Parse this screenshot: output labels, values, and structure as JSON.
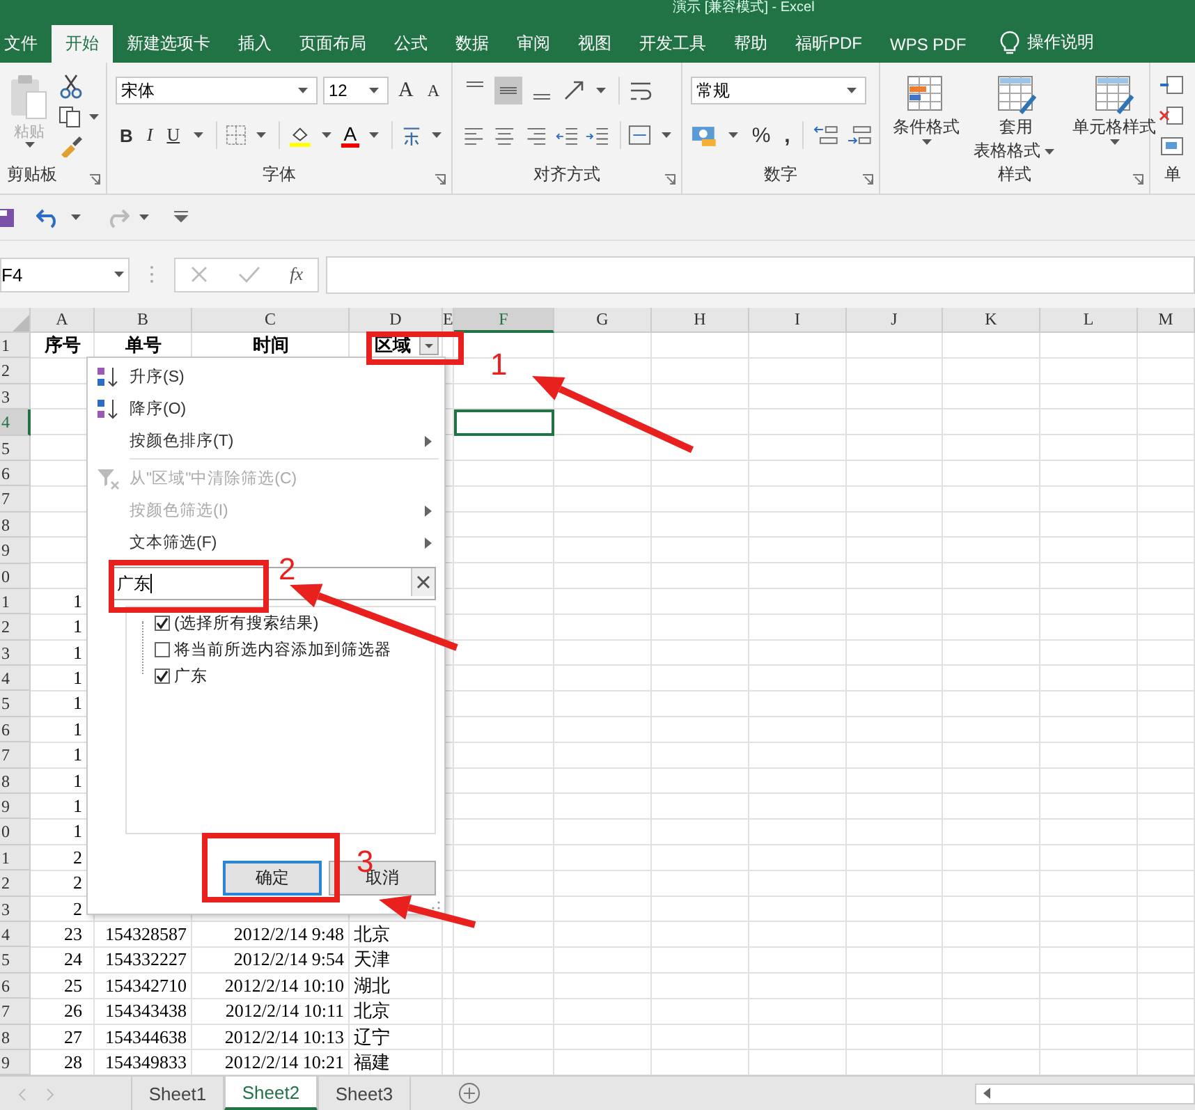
{
  "window": {
    "title": "演示 [兼容模式] - Excel"
  },
  "tabs": [
    {
      "label": "文件",
      "selected": false
    },
    {
      "label": "开始",
      "selected": true
    },
    {
      "label": "新建选项卡",
      "selected": false
    },
    {
      "label": "插入",
      "selected": false
    },
    {
      "label": "页面布局",
      "selected": false
    },
    {
      "label": "公式",
      "selected": false
    },
    {
      "label": "数据",
      "selected": false
    },
    {
      "label": "审阅",
      "selected": false
    },
    {
      "label": "视图",
      "selected": false
    },
    {
      "label": "开发工具",
      "selected": false
    },
    {
      "label": "帮助",
      "selected": false
    },
    {
      "label": "福昕PDF",
      "selected": false
    },
    {
      "label": "WPS PDF",
      "selected": false
    }
  ],
  "tell_me": "操作说明",
  "ribbon": {
    "groups": [
      {
        "kind": "clipboard",
        "label": "剪贴板",
        "paste": {
          "label": "粘贴",
          "disabled": true
        }
      },
      {
        "kind": "font",
        "label": "字体",
        "font_name": "宋体",
        "font_size": "12",
        "grow": "A",
        "shrink": "A",
        "bold": "B",
        "italic": "I",
        "underline": "U",
        "font_color": "A"
      },
      {
        "kind": "alignment",
        "label": "对齐方式",
        "align_buttons": [
          {
            "kind": "top",
            "selected": false
          },
          {
            "kind": "middle",
            "selected": true
          },
          {
            "kind": "bottom",
            "selected": false
          }
        ]
      },
      {
        "kind": "number",
        "label": "数字",
        "format": "常规",
        "percent": "%",
        "comma": ","
      },
      {
        "kind": "styles",
        "label": "样式",
        "buttons": [
          {
            "lines": [
              "条件格式"
            ]
          },
          {
            "lines": [
              "套用",
              "表格格式"
            ]
          },
          {
            "lines": [
              "单元格样式"
            ]
          }
        ]
      },
      {
        "kind": "cells",
        "label": "单"
      }
    ]
  },
  "name_box": "F4",
  "formula_bar": {
    "fx": "fx"
  },
  "columns": [
    {
      "label": "A",
      "selected": false
    },
    {
      "label": "B",
      "selected": false
    },
    {
      "label": "C",
      "selected": false
    },
    {
      "label": "D",
      "selected": false
    },
    {
      "label": "E",
      "selected": false
    },
    {
      "label": "F",
      "selected": true
    },
    {
      "label": "G",
      "selected": false
    },
    {
      "label": "H",
      "selected": false
    },
    {
      "label": "I",
      "selected": false
    },
    {
      "label": "J",
      "selected": false
    },
    {
      "label": "K",
      "selected": false
    },
    {
      "label": "L",
      "selected": false
    },
    {
      "label": "M",
      "selected": false
    }
  ],
  "rows": [
    {
      "label": "1",
      "selected": false,
      "kind": "header",
      "a": "序号",
      "b": "单号",
      "c": "时间",
      "d": "区域",
      "filter_button": true
    },
    {
      "label": "2",
      "selected": false
    },
    {
      "label": "3",
      "selected": false
    },
    {
      "label": "4",
      "selected": true
    },
    {
      "label": "5",
      "selected": false
    },
    {
      "label": "6",
      "selected": false
    },
    {
      "label": "7",
      "selected": false
    },
    {
      "label": "8",
      "selected": false
    },
    {
      "label": "9",
      "selected": false
    },
    {
      "label": "0",
      "selected": false
    },
    {
      "label": "1",
      "selected": false,
      "kind": "data",
      "a": "1"
    },
    {
      "label": "2",
      "selected": false,
      "kind": "data",
      "a": "1"
    },
    {
      "label": "3",
      "selected": false,
      "kind": "data",
      "a": "1"
    },
    {
      "label": "4",
      "selected": false,
      "kind": "data",
      "a": "1"
    },
    {
      "label": "5",
      "selected": false,
      "kind": "data",
      "a": "1"
    },
    {
      "label": "6",
      "selected": false,
      "kind": "data",
      "a": "1"
    },
    {
      "label": "7",
      "selected": false,
      "kind": "data",
      "a": "1"
    },
    {
      "label": "8",
      "selected": false,
      "kind": "data",
      "a": "1"
    },
    {
      "label": "9",
      "selected": false,
      "kind": "data",
      "a": "1"
    },
    {
      "label": "0",
      "selected": false,
      "kind": "data",
      "a": "1"
    },
    {
      "label": "1",
      "selected": false,
      "kind": "data",
      "a": "2"
    },
    {
      "label": "2",
      "selected": false,
      "kind": "data",
      "a": "2"
    },
    {
      "label": "3",
      "selected": false,
      "kind": "data",
      "a": "2"
    },
    {
      "label": "4",
      "selected": false,
      "kind": "data",
      "a": "23",
      "b": "154328587",
      "c": "2012/2/14 9:48",
      "d": "北京"
    },
    {
      "label": "5",
      "selected": false,
      "kind": "data",
      "a": "24",
      "b": "154332227",
      "c": "2012/2/14 9:54",
      "d": "天津"
    },
    {
      "label": "6",
      "selected": false,
      "kind": "data",
      "a": "25",
      "b": "154342710",
      "c": "2012/2/14 10:10",
      "d": "湖北"
    },
    {
      "label": "7",
      "selected": false,
      "kind": "data",
      "a": "26",
      "b": "154343438",
      "c": "2012/2/14 10:11",
      "d": "北京"
    },
    {
      "label": "8",
      "selected": false,
      "kind": "data",
      "a": "27",
      "b": "154344638",
      "c": "2012/2/14 10:13",
      "d": "辽宁"
    },
    {
      "label": "9",
      "selected": false,
      "kind": "data",
      "a": "28",
      "b": "154349833",
      "c": "2012/2/14 10:21",
      "d": "福建"
    }
  ],
  "filter_menu": {
    "items": [
      {
        "kind": "sort-asc",
        "label": "升序(S)",
        "disabled": false,
        "submenu": false
      },
      {
        "kind": "sort-desc",
        "label": "降序(O)",
        "disabled": false,
        "submenu": false
      },
      {
        "kind": "item",
        "label": "按颜色排序(T)",
        "disabled": false,
        "submenu": true
      },
      {
        "kind": "separator"
      },
      {
        "kind": "clear-filter",
        "label": "从\"区域\"中清除筛选(C)",
        "disabled": true,
        "submenu": false
      },
      {
        "kind": "item",
        "label": "按颜色筛选(I)",
        "disabled": true,
        "submenu": true
      },
      {
        "kind": "item",
        "label": "文本筛选(F)",
        "disabled": false,
        "submenu": true
      }
    ],
    "search": {
      "value": "广东"
    },
    "list": [
      {
        "label": "(选择所有搜索结果)",
        "checked": true
      },
      {
        "label": "将当前所选内容添加到筛选器",
        "checked": false
      },
      {
        "label": "广东",
        "checked": true
      }
    ],
    "buttons": [
      {
        "label": "确定",
        "focused": true
      },
      {
        "label": "取消",
        "focused": false
      }
    ]
  },
  "annotations": [
    {
      "label": "1"
    },
    {
      "label": "2"
    },
    {
      "label": "3"
    }
  ],
  "sheet_tabs": [
    {
      "label": "Sheet1",
      "selected": false
    },
    {
      "label": "Sheet2",
      "selected": true
    },
    {
      "label": "Sheet3",
      "selected": false
    }
  ]
}
